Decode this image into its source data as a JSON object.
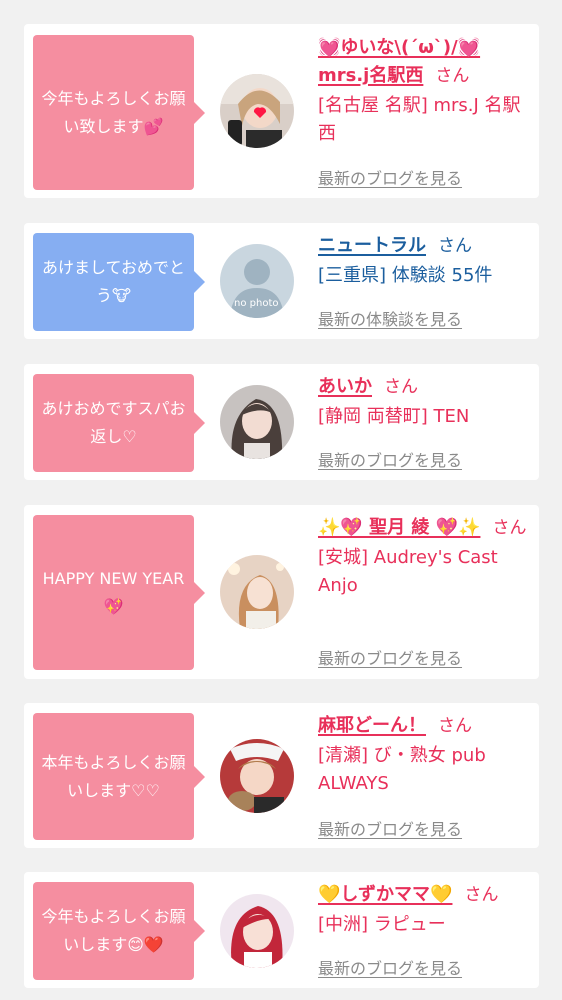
{
  "posts": [
    {
      "message": "今年もよろしくお願い致します💕",
      "name": "💓ゆいな\\(´ω`)/💓mrs.j名駅西",
      "honorific": "さん",
      "shop": "[名古屋 名駅] mrs.J 名駅西",
      "link": "最新のブログを見る",
      "bubble_color": "#f58ea0"
    },
    {
      "message": "あけましておめでとう🐮",
      "name": "ニュートラル",
      "honorific": "さん",
      "shop": "[三重県] 体験談 55件",
      "link": "最新の体験談を見る",
      "avatar_caption": "no photo",
      "bubble_color": "#86aef2"
    },
    {
      "message": "あけおめですスパお返し♡",
      "name": "あいか",
      "honorific": "さん",
      "shop": "[静岡 両替町] TEN",
      "link": "最新のブログを見る",
      "bubble_color": "#f58ea0"
    },
    {
      "message": "HAPPY NEW YEAR💖",
      "name": "✨💖 聖月 綾 💖✨",
      "honorific": "さん",
      "shop": "[安城] Audrey's Cast Anjo",
      "link": "最新のブログを見る",
      "bubble_color": "#f58ea0"
    },
    {
      "message": "本年もよろしくお願いします♡♡",
      "name": "麻耶どーん！",
      "honorific": "さん",
      "shop": "[清瀬] び・熟女 pub ALWAYS",
      "link": "最新のブログを見る",
      "bubble_color": "#f58ea0"
    },
    {
      "message": "今年もよろしくお願いします😊❤️",
      "name": "💛しずかママ💛",
      "honorific": "さん",
      "shop": "[中洲] ラピュー",
      "link": "最新のブログを見る",
      "bubble_color": "#f58ea0"
    }
  ]
}
